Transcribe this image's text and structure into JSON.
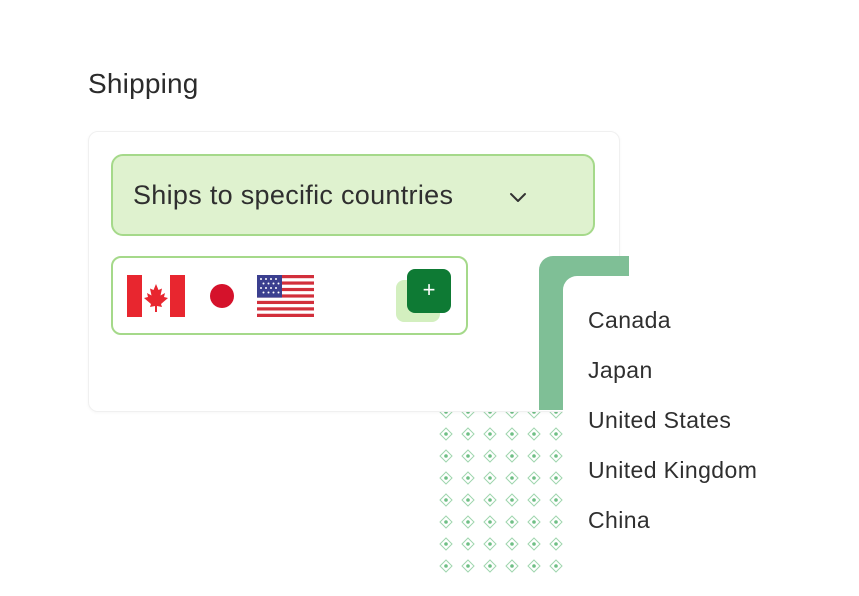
{
  "shipping": {
    "title": "Shipping",
    "select": {
      "value": "Ships to specific countries"
    },
    "selected_countries": [
      {
        "name": "Canada",
        "flag_icon": "canada-flag-icon"
      },
      {
        "name": "Japan",
        "flag_icon": "japan-flag-icon"
      },
      {
        "name": "United States",
        "flag_icon": "united-states-flag-icon"
      }
    ],
    "add_button": {
      "label": "+",
      "icon": "plus-icon",
      "color": "#0e7a34"
    },
    "dropdown": {
      "options": [
        "Canada",
        "Japan",
        "United States",
        "United Kingdom",
        "China"
      ]
    }
  },
  "colors": {
    "select_fill": "#dff2cf",
    "select_border": "#a5d98a",
    "accent_green": "#7fbf96",
    "dot_green": "#8fcf9f"
  }
}
